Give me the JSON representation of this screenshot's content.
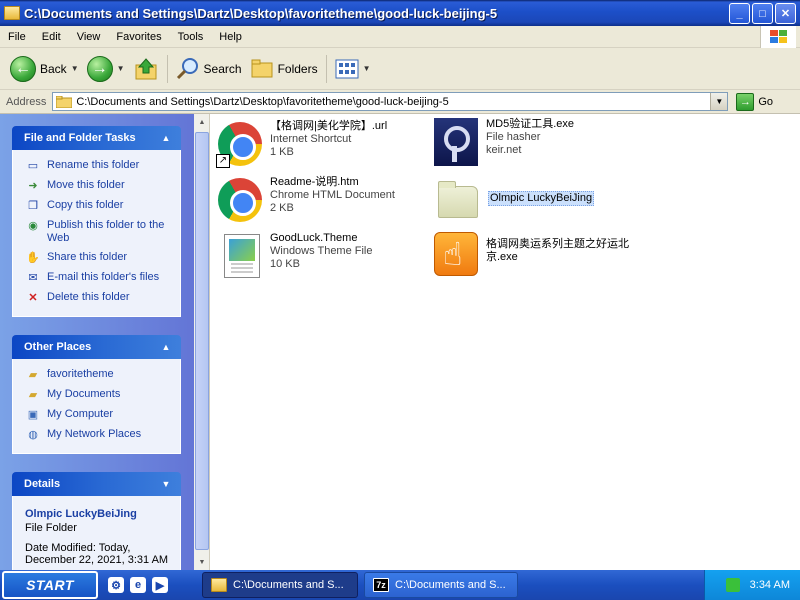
{
  "window": {
    "title": "C:\\Documents and Settings\\Dartz\\Desktop\\favoritetheme\\good-luck-beijing-5",
    "buttons": {
      "minimize": "_",
      "maximize": "□",
      "close": "✕"
    }
  },
  "menu": [
    "File",
    "Edit",
    "View",
    "Favorites",
    "Tools",
    "Help"
  ],
  "toolbar": {
    "back": "Back",
    "search": "Search",
    "folders": "Folders"
  },
  "address": {
    "label": "Address",
    "value": "C:\\Documents and Settings\\Dartz\\Desktop\\favoritetheme\\good-luck-beijing-5",
    "go": "Go"
  },
  "tasks_panel": {
    "title": "File and Folder Tasks",
    "items": [
      {
        "label": "Rename this folder",
        "icon": "rename-icon"
      },
      {
        "label": "Move this folder",
        "icon": "move-icon"
      },
      {
        "label": "Copy this folder",
        "icon": "copy-icon"
      },
      {
        "label": "Publish this folder to the Web",
        "icon": "publish-icon"
      },
      {
        "label": "Share this folder",
        "icon": "share-icon"
      },
      {
        "label": "E-mail this folder's files",
        "icon": "email-icon"
      },
      {
        "label": "Delete this folder",
        "icon": "delete-icon"
      }
    ]
  },
  "places_panel": {
    "title": "Other Places",
    "items": [
      {
        "label": "favoritetheme",
        "icon": "folder-icon"
      },
      {
        "label": "My Documents",
        "icon": "documents-icon"
      },
      {
        "label": "My Computer",
        "icon": "computer-icon"
      },
      {
        "label": "My Network Places",
        "icon": "network-icon"
      }
    ]
  },
  "details_panel": {
    "title": "Details",
    "name": "Olmpic LuckyBeiJing",
    "type": "File Folder",
    "modified": "Date Modified: Today, December 22, 2021, 3:31 AM"
  },
  "files": [
    {
      "name": "【格调网|美化学院】.url",
      "line2": "Internet Shortcut",
      "line3": "1 KB",
      "icon": "chrome-shortcut-icon"
    },
    {
      "name": "MD5验证工具.exe",
      "line2": "File hasher",
      "line3": "keir.net",
      "icon": "key-app-icon"
    },
    {
      "name": "Readme-说明.htm",
      "line2": "Chrome HTML Document",
      "line3": "2 KB",
      "icon": "chrome-icon"
    },
    {
      "name": "Olmpic LuckyBeiJing",
      "line2": "",
      "line3": "",
      "icon": "folder-icon"
    },
    {
      "name": "GoodLuck.Theme",
      "line2": "Windows Theme File",
      "line3": "10 KB",
      "icon": "theme-file-icon"
    },
    {
      "name": "格调网奥运系列主题之好运北京.exe",
      "line2": "",
      "line3": "",
      "icon": "hand-app-icon"
    }
  ],
  "taskbar": {
    "start": "START",
    "tasks": [
      "C:\\Documents and S...",
      "C:\\Documents and S..."
    ],
    "clock": "3:34 AM"
  }
}
